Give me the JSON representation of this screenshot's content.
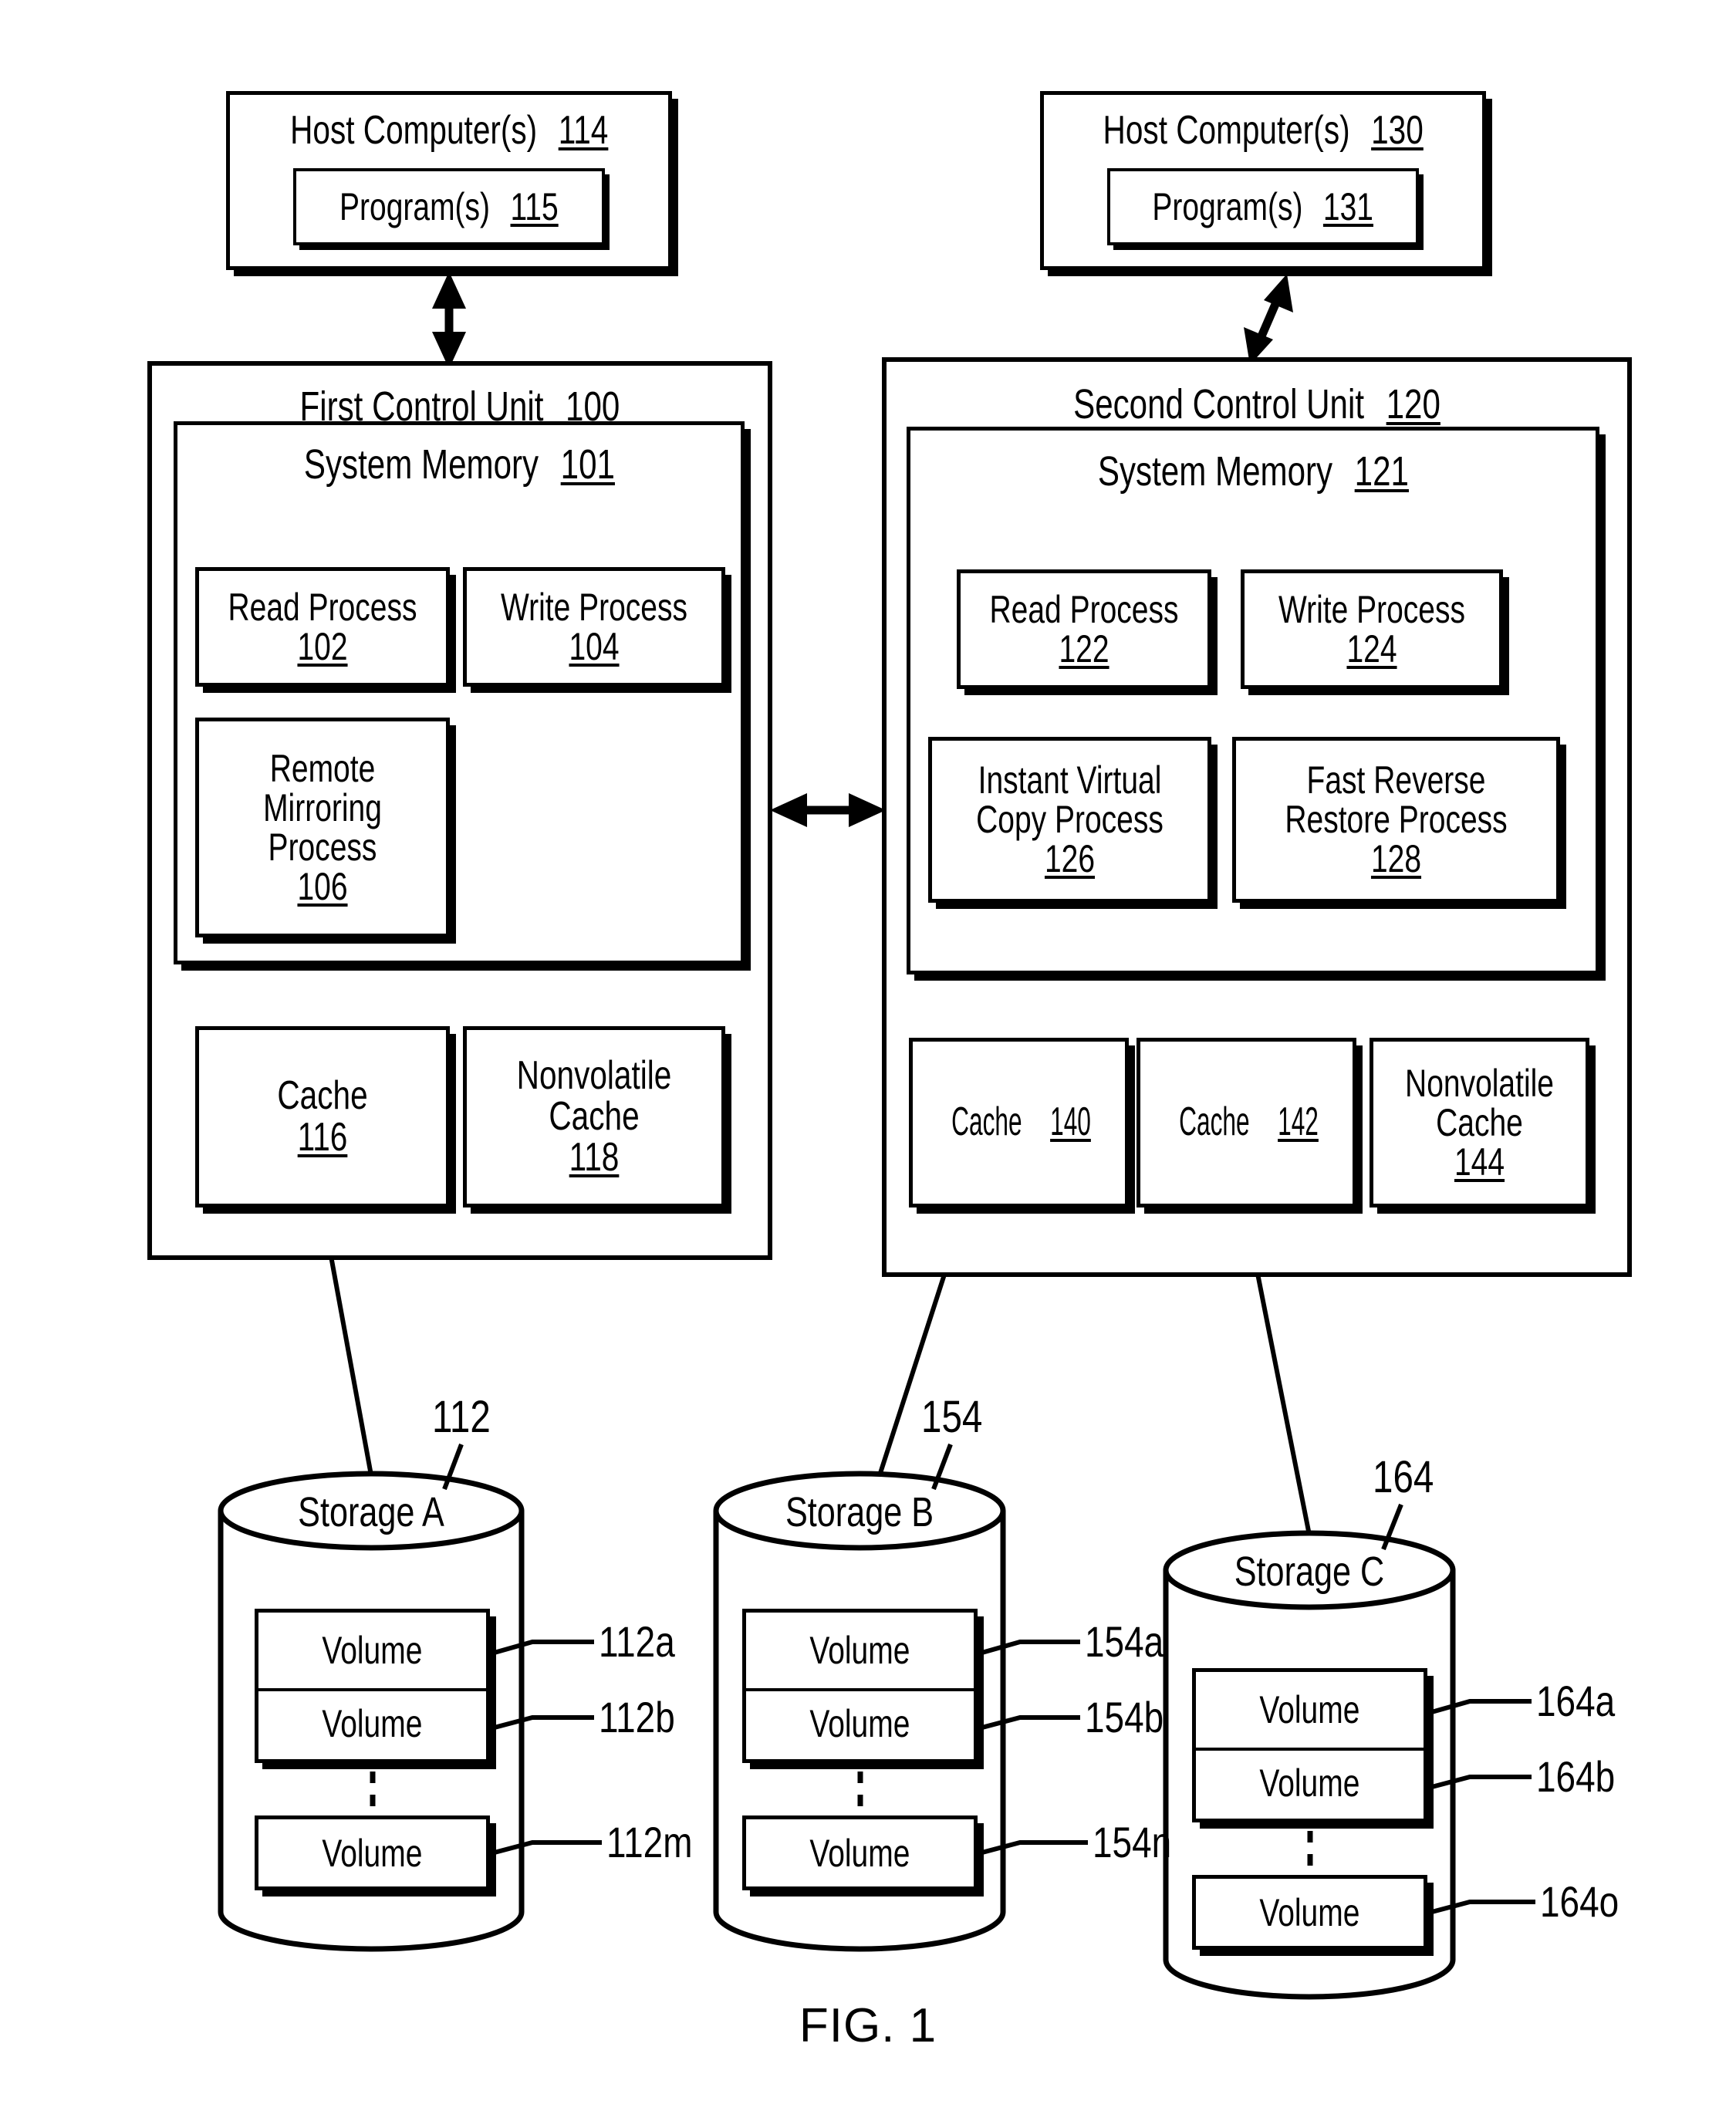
{
  "figure": {
    "caption": "FIG. 1"
  },
  "hosts": [
    {
      "title": "Host Computer(s)",
      "ref": "114",
      "program": {
        "title": "Program(s)",
        "ref": "115"
      }
    },
    {
      "title": "Host Computer(s)",
      "ref": "130",
      "program": {
        "title": "Program(s)",
        "ref": "131"
      }
    }
  ],
  "control_units": [
    {
      "title": "First Control Unit",
      "ref": "100",
      "memory": {
        "title": "System Memory",
        "ref": "101"
      },
      "processes": [
        {
          "title": "Read Process",
          "ref": "102"
        },
        {
          "title": "Write Process",
          "ref": "104"
        },
        {
          "title": "Remote Mirroring Process",
          "ref": "106"
        }
      ],
      "caches": [
        {
          "title": "Cache",
          "ref": "116"
        },
        {
          "title": "Nonvolatile Cache",
          "ref": "118"
        }
      ]
    },
    {
      "title": "Second Control Unit",
      "ref": "120",
      "memory": {
        "title": "System Memory",
        "ref": "121"
      },
      "processes": [
        {
          "title": "Read Process",
          "ref": "122"
        },
        {
          "title": "Write Process",
          "ref": "124"
        },
        {
          "title": "Instant Virtual Copy Process",
          "ref": "126"
        },
        {
          "title": "Fast Reverse Restore Process",
          "ref": "128"
        }
      ],
      "caches": [
        {
          "title": "Cache",
          "ref": "140"
        },
        {
          "title": "Cache",
          "ref": "142"
        },
        {
          "title": "Nonvolatile Cache",
          "ref": "144"
        }
      ]
    }
  ],
  "storages": [
    {
      "title": "Storage A",
      "ref": "112",
      "volume_label": "Volume",
      "volumes": [
        {
          "label": "Volume",
          "ref": "112a"
        },
        {
          "label": "Volume",
          "ref": "112b"
        },
        {
          "label": "Volume",
          "ref": "112m"
        }
      ]
    },
    {
      "title": "Storage B",
      "ref": "154",
      "volume_label": "Volume",
      "volumes": [
        {
          "label": "Volume",
          "ref": "154a"
        },
        {
          "label": "Volume",
          "ref": "154b"
        },
        {
          "label": "Volume",
          "ref": "154n"
        }
      ]
    },
    {
      "title": "Storage C",
      "ref": "164",
      "volume_label": "Volume",
      "volumes": [
        {
          "label": "Volume",
          "ref": "164a"
        },
        {
          "label": "Volume",
          "ref": "164b"
        },
        {
          "label": "Volume",
          "ref": "164o"
        }
      ]
    }
  ],
  "connectors": {
    "host1_to_cu1": "double-arrow-vertical",
    "host2_to_cu2": "double-arrow-diagonal",
    "cu1_to_cu2": "double-arrow-horizontal",
    "cache116_to_storageA": "line",
    "cache140_to_storageB": "line",
    "cache142_to_storageC": "line"
  },
  "colors": {
    "ink": "#000000",
    "paper": "#ffffff"
  }
}
